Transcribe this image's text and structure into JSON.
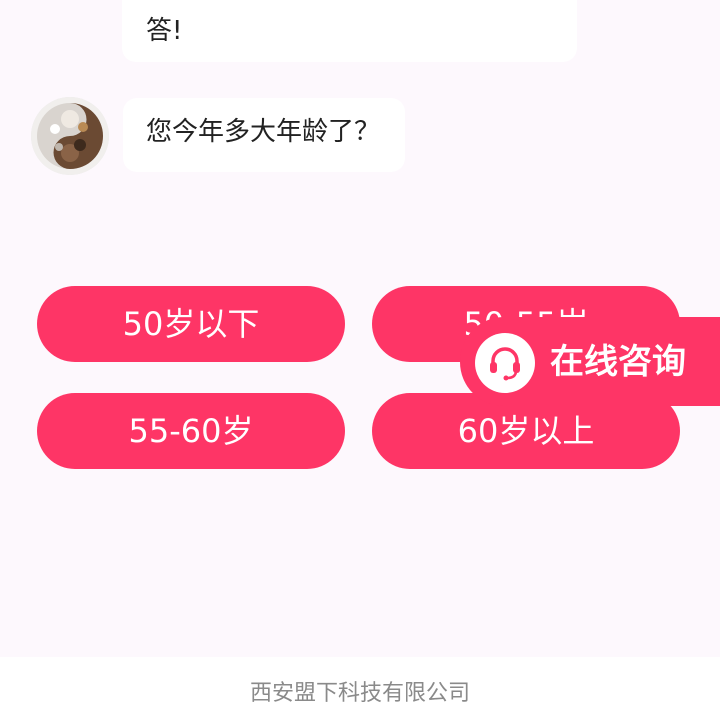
{
  "chat": {
    "prev_message_tail": "答!",
    "question": "您今年多大年龄了？"
  },
  "options": [
    {
      "label": "50岁以下"
    },
    {
      "label": "50-55岁"
    },
    {
      "label": "55-60岁"
    },
    {
      "label": "60岁以上"
    }
  ],
  "consult": {
    "label": "在线咨询",
    "icon": "headset-icon"
  },
  "footer": {
    "company": "西安盟下科技有限公司"
  },
  "colors": {
    "accent": "#fe3566",
    "page_bg": "#fdf8fd"
  }
}
